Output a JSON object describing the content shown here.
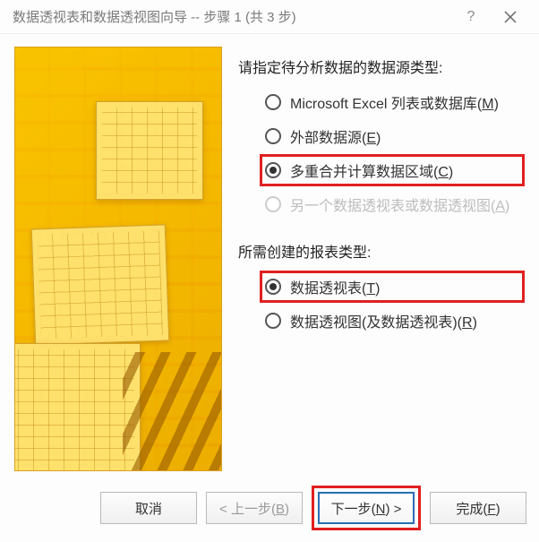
{
  "titlebar": {
    "title": "数据透视表和数据透视图向导 -- 步骤 1 (共 3 步)"
  },
  "section1": {
    "label": "请指定待分析数据的数据源类型:",
    "options": {
      "excel": {
        "text": "Microsoft Excel 列表或数据库(",
        "hotkey": "M",
        "suffix": ")"
      },
      "external": {
        "text": "外部数据源(",
        "hotkey": "E",
        "suffix": ")"
      },
      "multi": {
        "text": "多重合并计算数据区域(",
        "hotkey": "C",
        "suffix": ")"
      },
      "another": {
        "text": "另一个数据透视表或数据透视图(",
        "hotkey": "A",
        "suffix": ")"
      }
    }
  },
  "section2": {
    "label": "所需创建的报表类型:",
    "options": {
      "table": {
        "text": "数据透视表(",
        "hotkey": "T",
        "suffix": ")"
      },
      "chart": {
        "text": "数据透视图(及数据透视表)(",
        "hotkey": "R",
        "suffix": ")"
      }
    }
  },
  "buttons": {
    "cancel": "取消",
    "back_prefix": "< 上一步(",
    "back_hotkey": "B",
    "back_suffix": ")",
    "next_prefix": "下一步(",
    "next_hotkey": "N",
    "next_suffix": ") >",
    "finish_prefix": "完成(",
    "finish_hotkey": "F",
    "finish_suffix": ")"
  }
}
